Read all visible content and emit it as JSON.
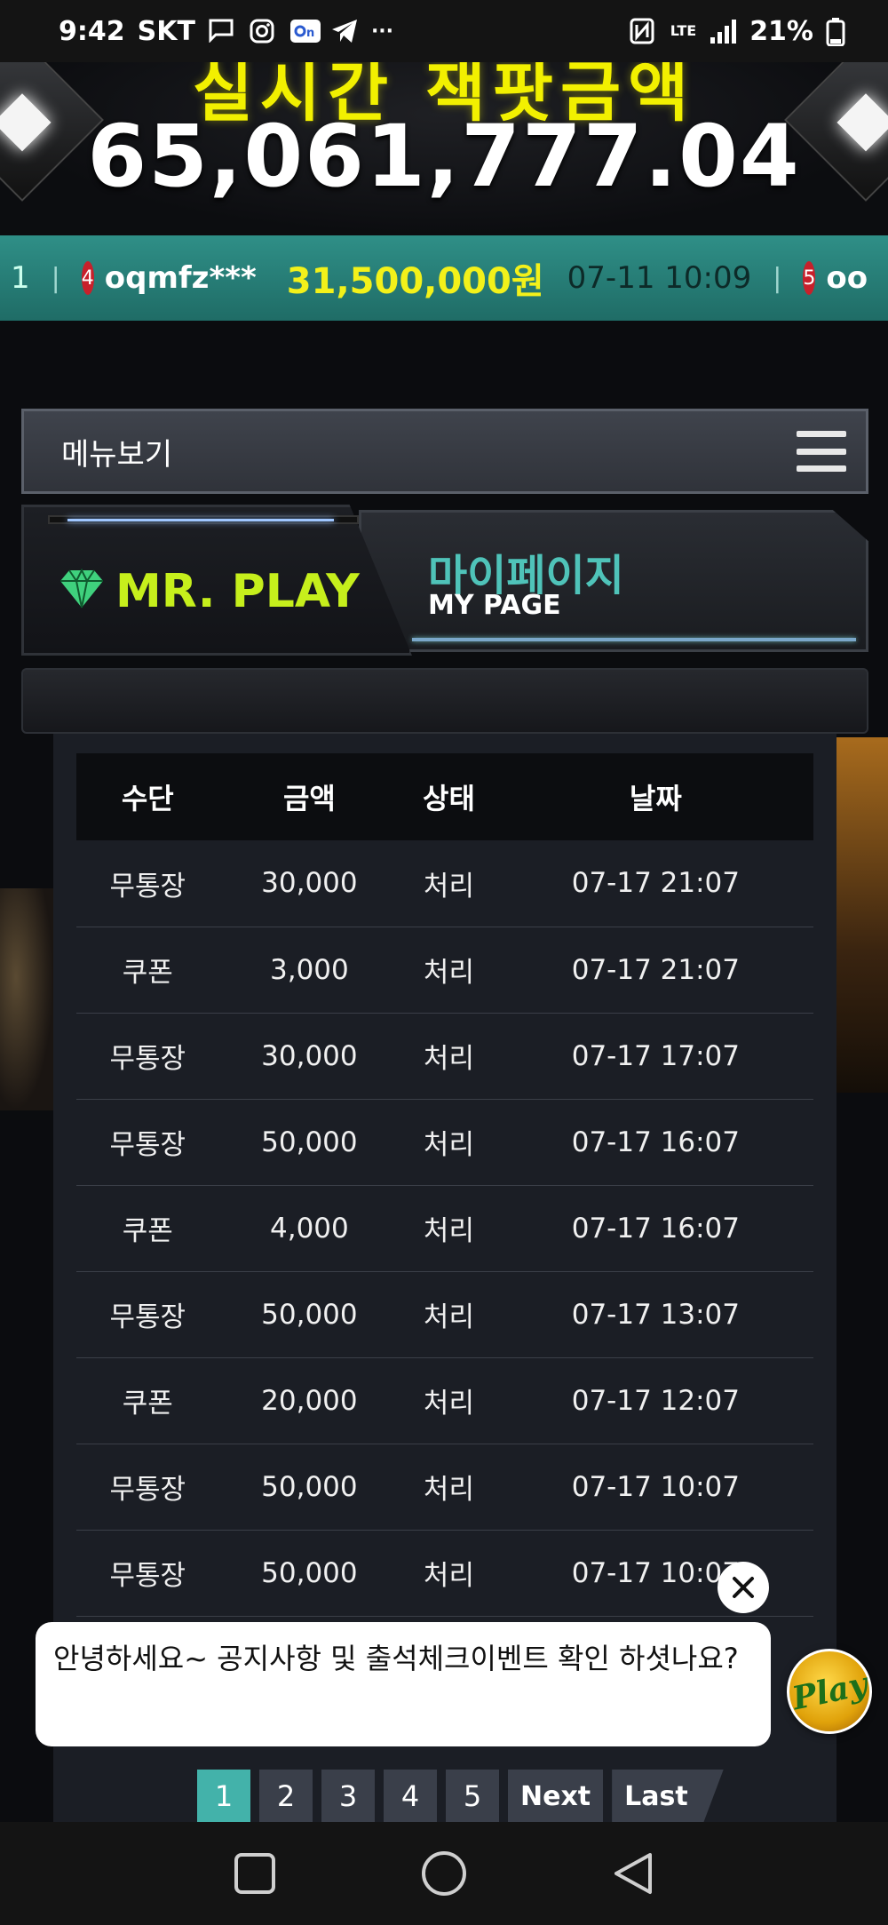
{
  "status_bar": {
    "time": "9:42",
    "carrier": "SKT",
    "network": "LTE",
    "battery": "21%"
  },
  "jackpot": {
    "title": "실시간 잭팟금액",
    "amount": "65,061,777.04"
  },
  "ticker": {
    "prev_partial": "1",
    "entry": {
      "rank": "4",
      "user": "oqmfz***",
      "amount": "31,500,000원",
      "date": "07-11 10:09"
    },
    "next_partial": {
      "rank": "5",
      "user": "oo"
    }
  },
  "menu": {
    "label": "메뉴보기"
  },
  "banner": {
    "logo": "MR. PLAY",
    "title_ko": "마이페이지",
    "title_en": "MY PAGE"
  },
  "table": {
    "headers": [
      "수단",
      "금액",
      "상태",
      "날짜"
    ],
    "rows": [
      [
        "무통장",
        "30,000",
        "처리",
        "07-17 21:07"
      ],
      [
        "쿠폰",
        "3,000",
        "처리",
        "07-17 21:07"
      ],
      [
        "무통장",
        "30,000",
        "처리",
        "07-17 17:07"
      ],
      [
        "무통장",
        "50,000",
        "처리",
        "07-17 16:07"
      ],
      [
        "쿠폰",
        "4,000",
        "처리",
        "07-17 16:07"
      ],
      [
        "무통장",
        "50,000",
        "처리",
        "07-17 13:07"
      ],
      [
        "쿠폰",
        "20,000",
        "처리",
        "07-17 12:07"
      ],
      [
        "무통장",
        "50,000",
        "처리",
        "07-17 10:07"
      ],
      [
        "무통장",
        "50,000",
        "처리",
        "07-17 10:07"
      ]
    ]
  },
  "chat": {
    "message": "안녕하세요~ 공지사항 및 출석체크이벤트 확인 하셧나요?",
    "avatar_text": "Play",
    "close_icon": "close-icon"
  },
  "pagination": {
    "pages": [
      "1",
      "2",
      "3",
      "4",
      "5"
    ],
    "active": "1",
    "next": "Next",
    "last": "Last"
  },
  "colors": {
    "accent_teal": "#43b2aa",
    "logo_green": "#c6ef1c",
    "jackpot_yellow": "#f2f000",
    "ticker_bg": "#2f8f87"
  }
}
